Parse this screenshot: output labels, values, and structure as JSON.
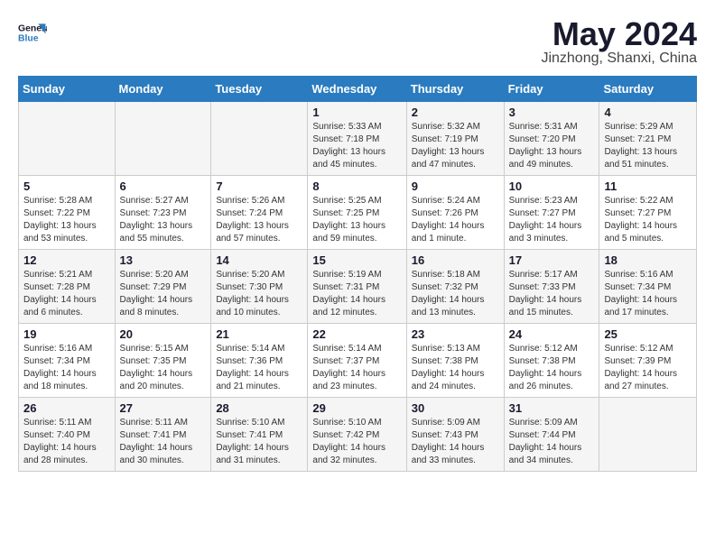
{
  "header": {
    "logo_line1": "General",
    "logo_line2": "Blue",
    "month": "May 2024",
    "location": "Jinzhong, Shanxi, China"
  },
  "weekdays": [
    "Sunday",
    "Monday",
    "Tuesday",
    "Wednesday",
    "Thursday",
    "Friday",
    "Saturday"
  ],
  "weeks": [
    [
      {
        "day": "",
        "info": ""
      },
      {
        "day": "",
        "info": ""
      },
      {
        "day": "",
        "info": ""
      },
      {
        "day": "1",
        "info": "Sunrise: 5:33 AM\nSunset: 7:18 PM\nDaylight: 13 hours\nand 45 minutes."
      },
      {
        "day": "2",
        "info": "Sunrise: 5:32 AM\nSunset: 7:19 PM\nDaylight: 13 hours\nand 47 minutes."
      },
      {
        "day": "3",
        "info": "Sunrise: 5:31 AM\nSunset: 7:20 PM\nDaylight: 13 hours\nand 49 minutes."
      },
      {
        "day": "4",
        "info": "Sunrise: 5:29 AM\nSunset: 7:21 PM\nDaylight: 13 hours\nand 51 minutes."
      }
    ],
    [
      {
        "day": "5",
        "info": "Sunrise: 5:28 AM\nSunset: 7:22 PM\nDaylight: 13 hours\nand 53 minutes."
      },
      {
        "day": "6",
        "info": "Sunrise: 5:27 AM\nSunset: 7:23 PM\nDaylight: 13 hours\nand 55 minutes."
      },
      {
        "day": "7",
        "info": "Sunrise: 5:26 AM\nSunset: 7:24 PM\nDaylight: 13 hours\nand 57 minutes."
      },
      {
        "day": "8",
        "info": "Sunrise: 5:25 AM\nSunset: 7:25 PM\nDaylight: 13 hours\nand 59 minutes."
      },
      {
        "day": "9",
        "info": "Sunrise: 5:24 AM\nSunset: 7:26 PM\nDaylight: 14 hours\nand 1 minute."
      },
      {
        "day": "10",
        "info": "Sunrise: 5:23 AM\nSunset: 7:27 PM\nDaylight: 14 hours\nand 3 minutes."
      },
      {
        "day": "11",
        "info": "Sunrise: 5:22 AM\nSunset: 7:27 PM\nDaylight: 14 hours\nand 5 minutes."
      }
    ],
    [
      {
        "day": "12",
        "info": "Sunrise: 5:21 AM\nSunset: 7:28 PM\nDaylight: 14 hours\nand 6 minutes."
      },
      {
        "day": "13",
        "info": "Sunrise: 5:20 AM\nSunset: 7:29 PM\nDaylight: 14 hours\nand 8 minutes."
      },
      {
        "day": "14",
        "info": "Sunrise: 5:20 AM\nSunset: 7:30 PM\nDaylight: 14 hours\nand 10 minutes."
      },
      {
        "day": "15",
        "info": "Sunrise: 5:19 AM\nSunset: 7:31 PM\nDaylight: 14 hours\nand 12 minutes."
      },
      {
        "day": "16",
        "info": "Sunrise: 5:18 AM\nSunset: 7:32 PM\nDaylight: 14 hours\nand 13 minutes."
      },
      {
        "day": "17",
        "info": "Sunrise: 5:17 AM\nSunset: 7:33 PM\nDaylight: 14 hours\nand 15 minutes."
      },
      {
        "day": "18",
        "info": "Sunrise: 5:16 AM\nSunset: 7:34 PM\nDaylight: 14 hours\nand 17 minutes."
      }
    ],
    [
      {
        "day": "19",
        "info": "Sunrise: 5:16 AM\nSunset: 7:34 PM\nDaylight: 14 hours\nand 18 minutes."
      },
      {
        "day": "20",
        "info": "Sunrise: 5:15 AM\nSunset: 7:35 PM\nDaylight: 14 hours\nand 20 minutes."
      },
      {
        "day": "21",
        "info": "Sunrise: 5:14 AM\nSunset: 7:36 PM\nDaylight: 14 hours\nand 21 minutes."
      },
      {
        "day": "22",
        "info": "Sunrise: 5:14 AM\nSunset: 7:37 PM\nDaylight: 14 hours\nand 23 minutes."
      },
      {
        "day": "23",
        "info": "Sunrise: 5:13 AM\nSunset: 7:38 PM\nDaylight: 14 hours\nand 24 minutes."
      },
      {
        "day": "24",
        "info": "Sunrise: 5:12 AM\nSunset: 7:38 PM\nDaylight: 14 hours\nand 26 minutes."
      },
      {
        "day": "25",
        "info": "Sunrise: 5:12 AM\nSunset: 7:39 PM\nDaylight: 14 hours\nand 27 minutes."
      }
    ],
    [
      {
        "day": "26",
        "info": "Sunrise: 5:11 AM\nSunset: 7:40 PM\nDaylight: 14 hours\nand 28 minutes."
      },
      {
        "day": "27",
        "info": "Sunrise: 5:11 AM\nSunset: 7:41 PM\nDaylight: 14 hours\nand 30 minutes."
      },
      {
        "day": "28",
        "info": "Sunrise: 5:10 AM\nSunset: 7:41 PM\nDaylight: 14 hours\nand 31 minutes."
      },
      {
        "day": "29",
        "info": "Sunrise: 5:10 AM\nSunset: 7:42 PM\nDaylight: 14 hours\nand 32 minutes."
      },
      {
        "day": "30",
        "info": "Sunrise: 5:09 AM\nSunset: 7:43 PM\nDaylight: 14 hours\nand 33 minutes."
      },
      {
        "day": "31",
        "info": "Sunrise: 5:09 AM\nSunset: 7:44 PM\nDaylight: 14 hours\nand 34 minutes."
      },
      {
        "day": "",
        "info": ""
      }
    ]
  ]
}
